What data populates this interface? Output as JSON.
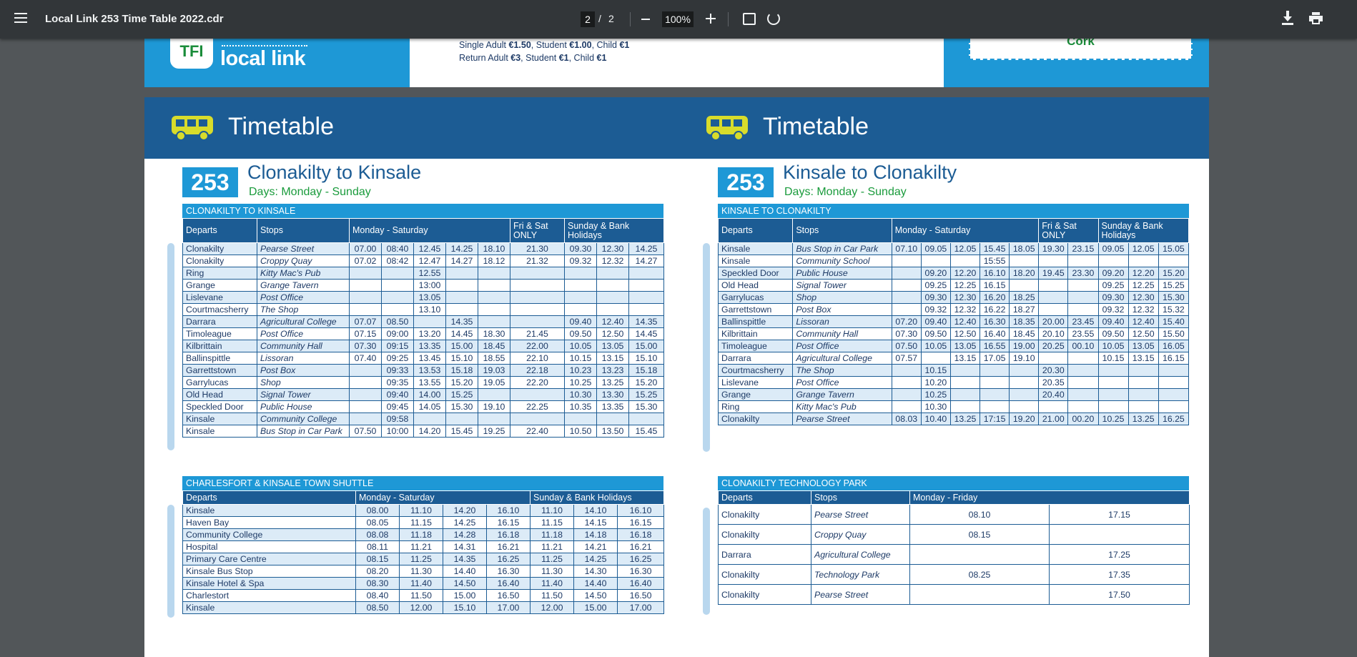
{
  "toolbar": {
    "title": "Local Link 253 Time Table 2022.cdr",
    "page_current": "2",
    "page_sep": "/",
    "page_total": "2",
    "zoom": "100%"
  },
  "top": {
    "logo_tfi": "TFI",
    "logo_text": "local link",
    "fare_line1_a": "Single Adult ",
    "fare_line1_b": "€1.50",
    "fare_line1_c": ", Student ",
    "fare_line1_d": "€1.00",
    "fare_line1_e": ", Child ",
    "fare_line1_f": "€1",
    "fare_line2_a": "Return Adult ",
    "fare_line2_b": "€3",
    "fare_line2_c": ", Student ",
    "fare_line2_d": "€1",
    "fare_line2_e": ", Child ",
    "fare_line2_f": "€1",
    "cork": "Cork"
  },
  "heading_left": "Timetable",
  "heading_right": "Timetable",
  "left": {
    "route": "253",
    "title": "Clonakilty to Kinsale",
    "days": "Days: Monday - Sunday",
    "section": "CLONAKILTY TO KINSALE",
    "cols": {
      "departs": "Departs",
      "stops": "Stops",
      "monsat": "Monday - Saturday",
      "frisat": "Fri & Sat ONLY",
      "sunbank": "Sunday & Bank Holidays"
    },
    "rows": [
      [
        "Clonakilty",
        "Pearse Street",
        "07.00",
        "08:40",
        "12.45",
        "14.25",
        "18.10",
        "21.30",
        "09.30",
        "12.30",
        "14.25"
      ],
      [
        "Clonakilty",
        "Croppy Quay",
        "07.02",
        "08:42",
        "12.47",
        "14.27",
        "18.12",
        "21.32",
        "09.32",
        "12.32",
        "14.27"
      ],
      [
        "Ring",
        "Kitty Mac's Pub",
        "",
        "",
        "12.55",
        "",
        "",
        "",
        "",
        "",
        ""
      ],
      [
        "Grange",
        "Grange Tavern",
        "",
        "",
        "13:00",
        "",
        "",
        "",
        "",
        "",
        ""
      ],
      [
        "Lislevane",
        "Post Office",
        "",
        "",
        "13.05",
        "",
        "",
        "",
        "",
        "",
        ""
      ],
      [
        "Courtmacsherry",
        "The Shop",
        "",
        "",
        "13.10",
        "",
        "",
        "",
        "",
        "",
        ""
      ],
      [
        "Darrara",
        "Agricultural College",
        "07.07",
        "08.50",
        "",
        "14.35",
        "",
        "",
        "09.40",
        "12.40",
        "14.35"
      ],
      [
        "Timoleague",
        "Post Office",
        "07.15",
        "09:00",
        "13.20",
        "14.45",
        "18.30",
        "21.45",
        "09.50",
        "12.50",
        "14.45"
      ],
      [
        "Kilbrittain",
        "Community Hall",
        "07.30",
        "09:15",
        "13.35",
        "15.00",
        "18.45",
        "22.00",
        "10.05",
        "13.05",
        "15.00"
      ],
      [
        "Ballinspittle",
        "Lissoran",
        "07.40",
        "09:25",
        "13.45",
        "15.10",
        "18.55",
        "22.10",
        "10.15",
        "13.15",
        "15.10"
      ],
      [
        "Garrettstown",
        "Post Box",
        "",
        "09:33",
        "13.53",
        "15.18",
        "19.03",
        "22.18",
        "10.23",
        "13.23",
        "15.18"
      ],
      [
        "Garrylucas",
        "Shop",
        "",
        "09:35",
        "13.55",
        "15.20",
        "19.05",
        "22.20",
        "10.25",
        "13.25",
        "15.20"
      ],
      [
        "Old Head",
        "Signal Tower",
        "",
        "09:40",
        "14.00",
        "15.25",
        "",
        "",
        "10.30",
        "13.30",
        "15.25"
      ],
      [
        "Speckled Door",
        "Public House",
        "",
        "09:45",
        "14.05",
        "15.30",
        "19.10",
        "22.25",
        "10.35",
        "13.35",
        "15.30"
      ],
      [
        "Kinsale",
        "Community College",
        "",
        "09:58",
        "",
        "",
        "",
        "",
        "",
        "",
        ""
      ],
      [
        "Kinsale",
        "Bus Stop in Car Park",
        "07.50",
        "10:00",
        "14.20",
        "15.45",
        "19.25",
        "22.40",
        "10.50",
        "13.50",
        "15.45"
      ]
    ]
  },
  "right": {
    "route": "253",
    "title": "Kinsale to Clonakilty",
    "days": "Days: Monday - Sunday",
    "section": "KINSALE TO CLONAKILTY",
    "cols": {
      "departs": "Departs",
      "stops": "Stops",
      "monsat": "Monday - Saturday",
      "frisat": "Fri & Sat ONLY",
      "sunbank": "Sunday & Bank Holidays"
    },
    "rows": [
      [
        "Kinsale",
        "Bus Stop in Car Park",
        "07.10",
        "09.05",
        "12.05",
        "15.45",
        "18.05",
        "19.30",
        "23.15",
        "09.05",
        "12.05",
        "15.05"
      ],
      [
        "Kinsale",
        "Community School",
        "",
        "",
        "",
        "15:55",
        "",
        "",
        "",
        "",
        "",
        ""
      ],
      [
        "Speckled Door",
        "Public House",
        "",
        "09.20",
        "12.20",
        "16.10",
        "18.20",
        "19.45",
        "23.30",
        "09.20",
        "12.20",
        "15.20"
      ],
      [
        "Old Head",
        "Signal Tower",
        "",
        "09.25",
        "12.25",
        "16.15",
        "",
        "",
        "",
        "09.25",
        "12.25",
        "15.25"
      ],
      [
        "Garrylucas",
        "Shop",
        "",
        "09.30",
        "12.30",
        "16.20",
        "18.25",
        "",
        "",
        "09.30",
        "12.30",
        "15.30"
      ],
      [
        "Garrettstown",
        "Post Box",
        "",
        "09.32",
        "12.32",
        "16.22",
        "18.27",
        "",
        "",
        "09.32",
        "12.32",
        "15.32"
      ],
      [
        "Ballinspittle",
        "Lissoran",
        "07.20",
        "09.40",
        "12.40",
        "16.30",
        "18.35",
        "20.00",
        "23.45",
        "09.40",
        "12.40",
        "15.40"
      ],
      [
        "Kilbrittain",
        "Community Hall",
        "07.30",
        "09.50",
        "12.50",
        "16.40",
        "18.45",
        "20.10",
        "23.55",
        "09.50",
        "12.50",
        "15.50"
      ],
      [
        "Timoleague",
        "Post Office",
        "07.50",
        "10.05",
        "13.05",
        "16.55",
        "19.00",
        "20.25",
        "00.10",
        "10.05",
        "13.05",
        "16.05"
      ],
      [
        "Darrara",
        "Agricultural College",
        "07.57",
        "",
        "13.15",
        "17.05",
        "19.10",
        "",
        "",
        "10.15",
        "13.15",
        "16.15"
      ],
      [
        "Courtmacsherry",
        "The Shop",
        "",
        "10.15",
        "",
        "",
        "",
        "20.30",
        "",
        "",
        "",
        ""
      ],
      [
        "Lislevane",
        "Post Office",
        "",
        "10.20",
        "",
        "",
        "",
        "20.35",
        "",
        "",
        "",
        ""
      ],
      [
        "Grange",
        "Grange Tavern",
        "",
        "10.25",
        "",
        "",
        "",
        "20.40",
        "",
        "",
        "",
        ""
      ],
      [
        "Ring",
        "Kitty Mac's Pub",
        "",
        "10.30",
        "",
        "",
        "",
        "",
        "",
        "",
        "",
        ""
      ],
      [
        "Clonakilty",
        "Pearse Street",
        "08.03",
        "10.40",
        "13.25",
        "17:15",
        "19.20",
        "21.00",
        "00.20",
        "10.25",
        "13.25",
        "16.25"
      ]
    ]
  },
  "shuttle": {
    "section": "CHARLESFORT & KINSALE TOWN SHUTTLE",
    "cols": {
      "departs": "Departs",
      "monsat": "Monday - Saturday",
      "sunbank": "Sunday & Bank Holidays"
    },
    "rows": [
      [
        "Kinsale",
        "08.00",
        "11.10",
        "14.20",
        "16.10",
        "11.10",
        "14.10",
        "16.10"
      ],
      [
        "Haven Bay",
        "08.05",
        "11.15",
        "14.25",
        "16.15",
        "11.15",
        "14.15",
        "16.15"
      ],
      [
        "Community College",
        "08.08",
        "11.18",
        "14.28",
        "16.18",
        "11.18",
        "14.18",
        "16.18"
      ],
      [
        "Hospital",
        "08.11",
        "11.21",
        "14.31",
        "16.21",
        "11.21",
        "14.21",
        "16.21"
      ],
      [
        "Primary Care Centre",
        "08.15",
        "11.25",
        "14.35",
        "16.25",
        "11.25",
        "14.25",
        "16.25"
      ],
      [
        "Kinsale Bus Stop",
        "08.20",
        "11.30",
        "14.40",
        "16.30",
        "11.30",
        "14.30",
        "16.30"
      ],
      [
        "Kinsale Hotel & Spa",
        "08.30",
        "11.40",
        "14.50",
        "16.40",
        "11.40",
        "14.40",
        "16.40"
      ],
      [
        "Charlestort",
        "08.40",
        "11.50",
        "15.00",
        "16.50",
        "11.50",
        "14.50",
        "16.50"
      ],
      [
        "Kinsale",
        "08.50",
        "12.00",
        "15.10",
        "17.00",
        "12.00",
        "15.00",
        "17.00"
      ]
    ]
  },
  "tech": {
    "section": "CLONAKILTY TECHNOLOGY PARK",
    "cols": {
      "departs": "Departs",
      "stops": "Stops",
      "monfri": "Monday - Friday"
    },
    "rows": [
      [
        "Clonakilty",
        "Pearse Street",
        "08.10",
        "17.15"
      ],
      [
        "Clonakilty",
        "Croppy Quay",
        "08.15",
        ""
      ],
      [
        "Darrara",
        "Agricultural College",
        "",
        "17.25"
      ],
      [
        "Clonakilty",
        "Technology Park",
        "08.25",
        "17.35"
      ],
      [
        "Clonakilty",
        "Pearse Street",
        "",
        "17.50"
      ]
    ]
  }
}
